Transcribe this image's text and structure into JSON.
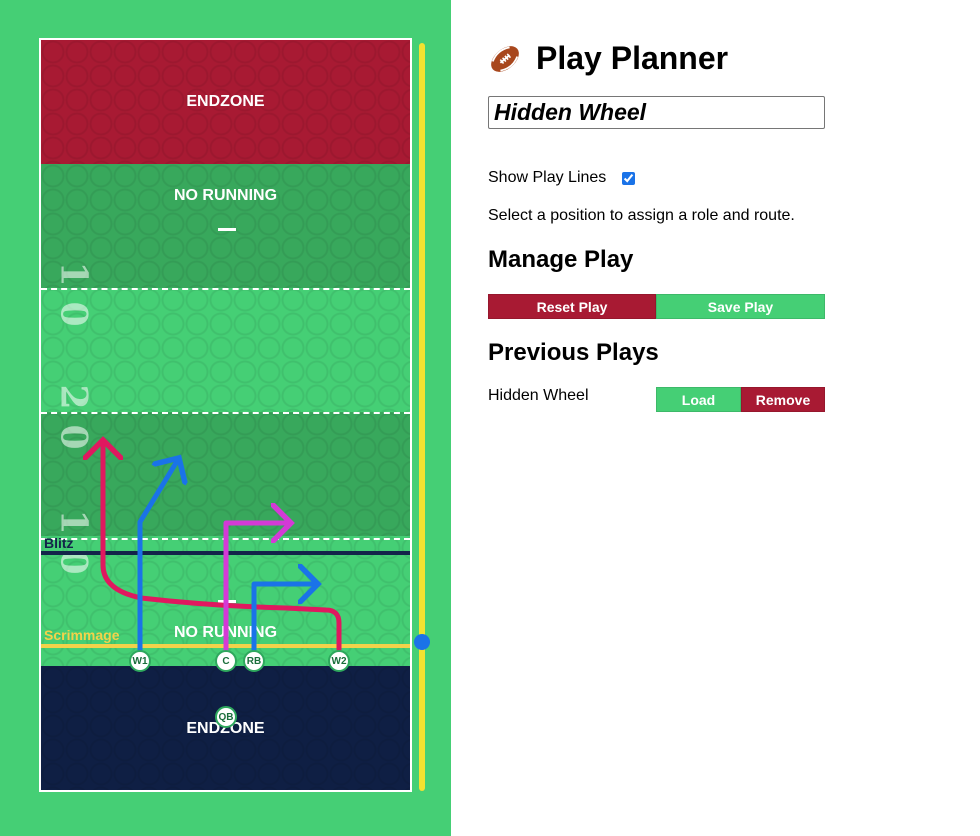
{
  "app": {
    "title": "Play Planner",
    "play_name": "Hidden Wheel"
  },
  "field": {
    "endzone_top_label": "ENDZONE",
    "endzone_bottom_label": "ENDZONE",
    "no_running_top_label": "NO RUNNING",
    "no_running_bottom_label": "NO RUNNING",
    "blitz_label": "Blitz",
    "scrimmage_label": "Scrimmage",
    "yard_numbers": [
      "1",
      "0",
      "2",
      "0",
      "1",
      "0"
    ],
    "players": [
      {
        "id": "w1",
        "label": "W1"
      },
      {
        "id": "c",
        "label": "C"
      },
      {
        "id": "rb",
        "label": "RB"
      },
      {
        "id": "w2",
        "label": "W2"
      },
      {
        "id": "qb",
        "label": "QB"
      }
    ],
    "colors": {
      "endzone_top": "#a81a33",
      "endzone_bottom": "#0f1f44",
      "field_dark": "#38a85c",
      "field_light": "#45cf75",
      "route_w1": "#1a73e8",
      "route_c": "#d43ad6",
      "route_rb": "#1a73e8",
      "route_w2": "#e0185f",
      "scrimmage": "#f3d24a",
      "blitz": "#13244a"
    }
  },
  "controls": {
    "show_lines_label": "Show Play Lines",
    "show_lines_checked": true,
    "help_text": "Select a position to assign a role and route.",
    "manage_heading": "Manage Play",
    "reset_label": "Reset Play",
    "save_label": "Save Play",
    "previous_heading": "Previous Plays",
    "previous_plays": [
      {
        "name": "Hidden Wheel",
        "load_label": "Load",
        "remove_label": "Remove"
      }
    ]
  }
}
